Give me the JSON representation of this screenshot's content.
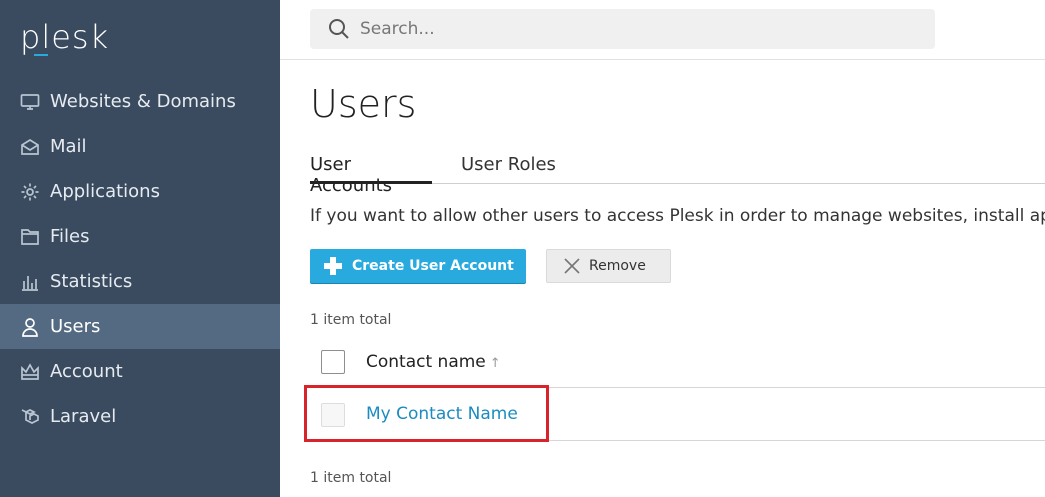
{
  "sidebar": {
    "logo": "plesk",
    "items": [
      {
        "label": "Websites & Domains",
        "icon": "monitor-icon"
      },
      {
        "label": "Mail",
        "icon": "mail-icon"
      },
      {
        "label": "Applications",
        "icon": "gear-icon"
      },
      {
        "label": "Files",
        "icon": "folder-icon"
      },
      {
        "label": "Statistics",
        "icon": "bar-chart-icon"
      },
      {
        "label": "Users",
        "icon": "user-icon",
        "active": true
      },
      {
        "label": "Account",
        "icon": "crown-icon"
      },
      {
        "label": "Laravel",
        "icon": "laravel-icon"
      }
    ]
  },
  "search": {
    "placeholder": "Search..."
  },
  "main": {
    "title": "Users",
    "tabs": [
      {
        "label": "User Accounts",
        "active": true
      },
      {
        "label": "User Roles",
        "active": false
      }
    ],
    "description": "If you want to allow other users to access Plesk in order to manage websites, install applications",
    "buttons": {
      "create": "Create User Account",
      "remove": "Remove"
    },
    "count_top": "1 item total",
    "count_bottom": "1 item total",
    "table": {
      "column_header": "Contact name",
      "sort_indicator": "↑",
      "rows": [
        {
          "name": "My Contact Name"
        }
      ]
    }
  },
  "colors": {
    "sidebar": "#3a4b5f",
    "active_item": "#536a82",
    "primary": "#28aade",
    "link": "#1a8cc0",
    "highlight": "#d9232a"
  }
}
